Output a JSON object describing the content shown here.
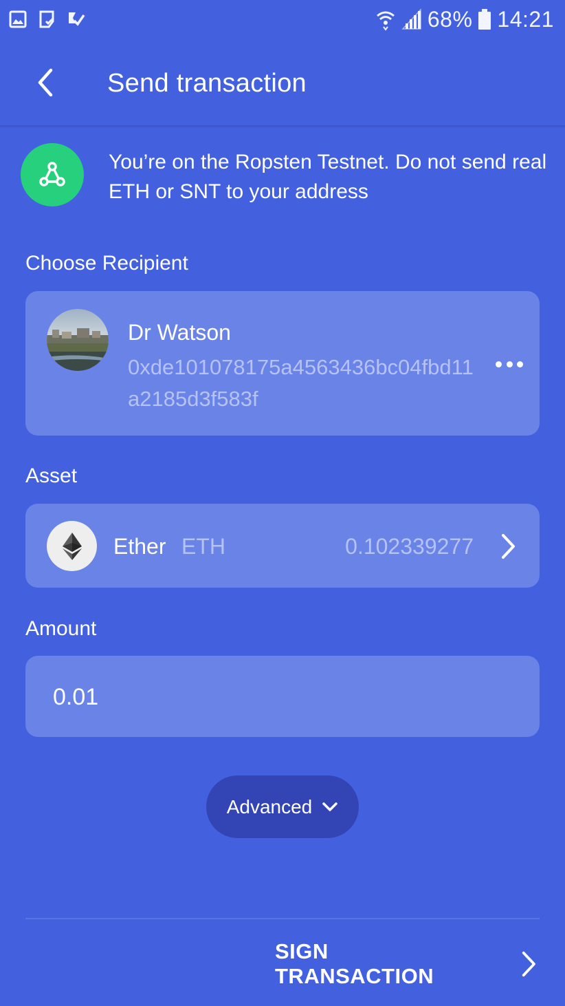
{
  "status_bar": {
    "left_icons": [
      "gallery-icon",
      "clipboard-check-icon",
      "flag-check-icon"
    ],
    "wifi_icon": "wifi-icon",
    "signal_icon": "signal-icon",
    "battery_percent": "68%",
    "battery_icon": "battery-icon",
    "time": "14:21"
  },
  "header": {
    "back_icon": "chevron-left-icon",
    "title": "Send transaction"
  },
  "network_banner": {
    "icon": "network-nodes-icon",
    "text": "You’re on the Ropsten Testnet. Do not send real ETH or SNT to your address"
  },
  "recipient": {
    "section_label": "Choose Recipient",
    "name": "Dr Watson",
    "address": "0xde101078175a4563436bc04fbd11a2185d3f583f",
    "more_icon": "more-horizontal-icon"
  },
  "asset": {
    "section_label": "Asset",
    "name": "Ether",
    "symbol": "ETH",
    "balance": "0.102339277",
    "icon": "ethereum-icon"
  },
  "amount": {
    "section_label": "Amount",
    "value": "0.01"
  },
  "advanced": {
    "label": "Advanced",
    "icon": "chevron-down-icon"
  },
  "footer": {
    "sign_label": "SIGN TRANSACTION",
    "icon": "chevron-right-icon"
  },
  "colors": {
    "background": "#4360df",
    "card": "#6a83e7",
    "accent_green": "#26d07c",
    "secondary_text": "#b5c2f3",
    "advanced_button": "#3344b5"
  }
}
